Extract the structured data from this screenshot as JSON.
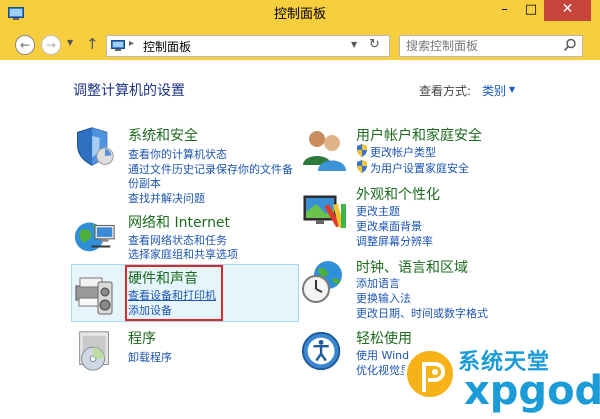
{
  "window": {
    "title": "控制面板",
    "minimize_glyph": "–",
    "maximize_glyph": "□",
    "close_glyph": "✕"
  },
  "nav": {
    "back_glyph": "←",
    "forward_glyph": "→",
    "recent_glyph": "▼",
    "up_glyph": "↑",
    "address_separator": "▸",
    "address_text": "控制面板",
    "address_dropdown_glyph": "▼",
    "refresh_glyph": "↻",
    "search_placeholder": "搜索控制面板"
  },
  "header": {
    "heading": "调整计算机的设置",
    "view_by_label": "查看方式:",
    "view_by_value": "类别",
    "view_by_arrow": "▼"
  },
  "categories": [
    {
      "icon": "shield-icon",
      "title": "系统和安全",
      "links": [
        "查看你的计算机状态",
        "通过文件历史记录保存你的文件备",
        "份副本",
        "查找并解决问题"
      ]
    },
    {
      "icon": "network-globe-icon",
      "title": "网络和 Internet",
      "links": [
        "查看网络状态和任务",
        "选择家庭组和共享选项"
      ]
    },
    {
      "icon": "printer-speaker-icon",
      "title": "硬件和声音",
      "links": [
        "查看设备和打印机",
        "添加设备"
      ]
    },
    {
      "icon": "programs-disc-icon",
      "title": "程序",
      "links": [
        "卸载程序"
      ]
    },
    {
      "icon": "users-icon",
      "title": "用户帐户和家庭安全",
      "links": [
        "更改帐户类型",
        "为用户设置家庭安全"
      ]
    },
    {
      "icon": "appearance-icon",
      "title": "外观和个性化",
      "links": [
        "更改主题",
        "更改桌面背景",
        "调整屏幕分辨率"
      ]
    },
    {
      "icon": "clock-globe-icon",
      "title": "时钟、语言和区域",
      "links": [
        "添加语言",
        "更换输入法",
        "更改日期、时间或数字格式"
      ]
    },
    {
      "icon": "ease-of-access-icon",
      "title": "轻松使用",
      "links": [
        "使用 Wind",
        "优化视觉显"
      ]
    }
  ],
  "colors": {
    "titlebar": "#f7ce3e",
    "close_button": "#c7443b",
    "category_title": "#1d6a1e",
    "link": "#1e55b3",
    "highlight": "#e6f4fb",
    "annotation_red": "#d82a2a",
    "watermark_blue": "#1b9bd7",
    "watermark_orange": "#f7b217"
  },
  "watermark": {
    "text_cn": "系统天堂",
    "text_en": "xpgod"
  }
}
